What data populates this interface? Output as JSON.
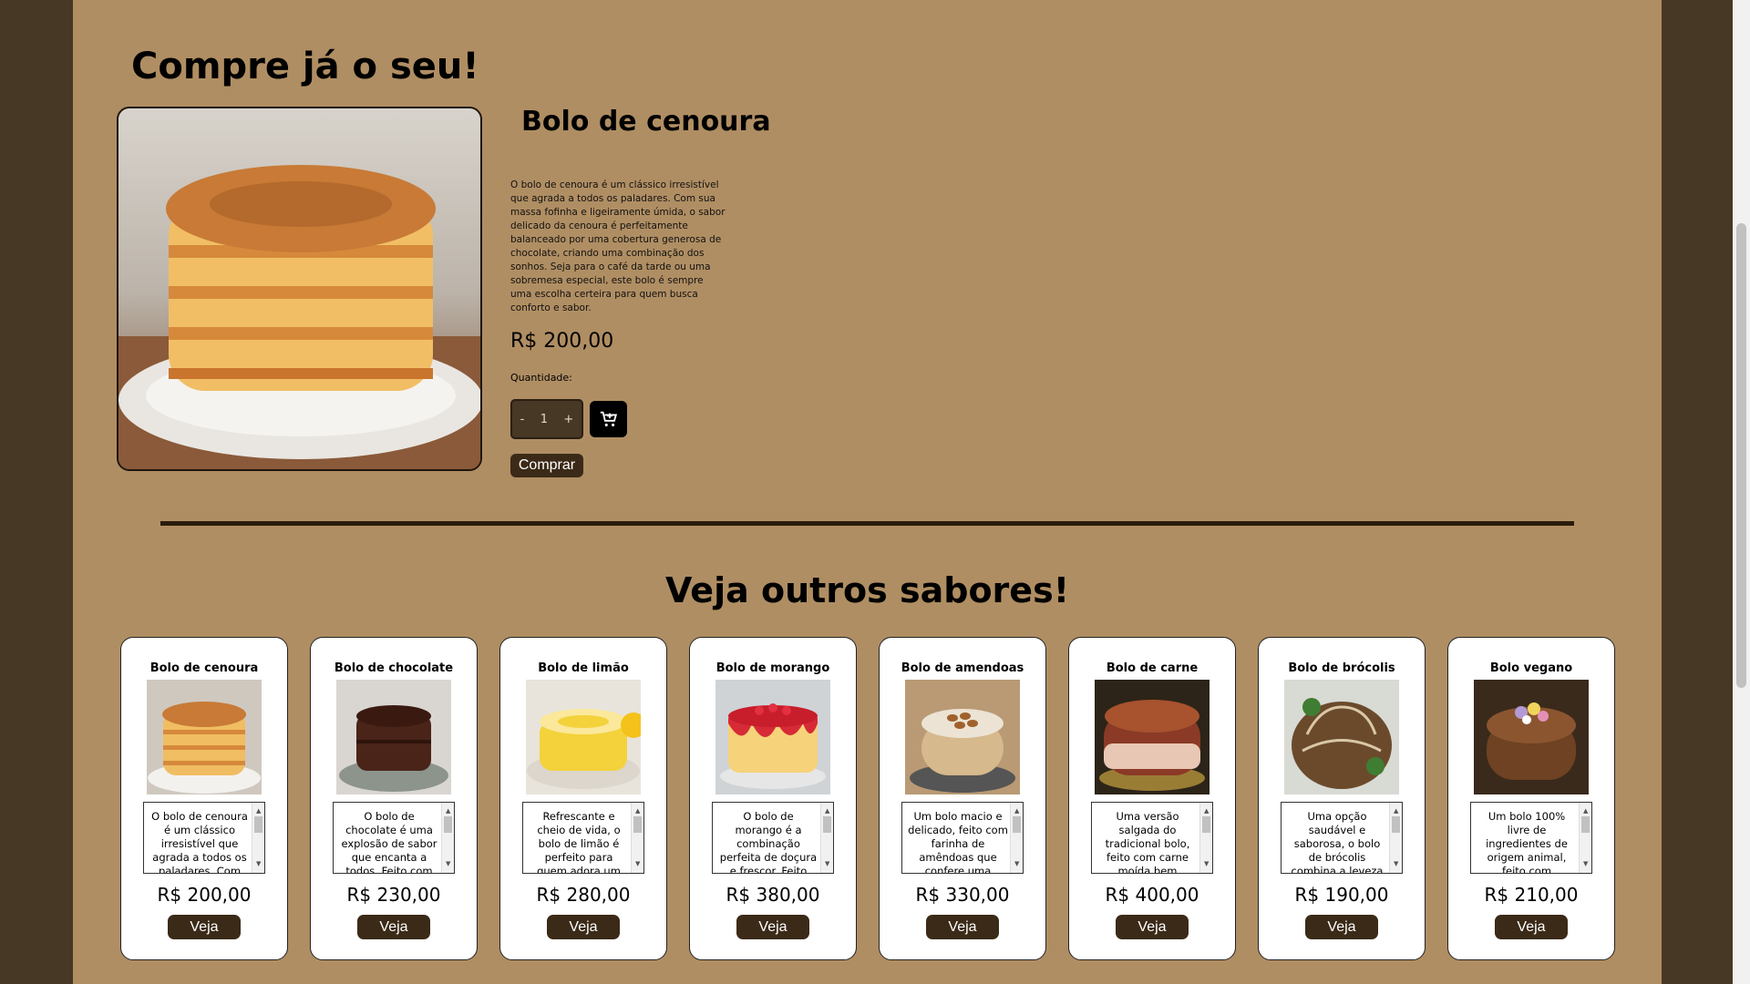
{
  "section_title": "Compre já o seu!",
  "product": {
    "name": "Bolo de cenoura",
    "description": "O bolo de cenoura é um clássico irresistível que agrada a todos os paladares. Com sua massa fofinha e ligeiramente úmida, o sabor delicado da cenoura é perfeitamente balanceado por uma cobertura generosa de chocolate, criando uma combinação dos sonhos. Seja para o café da tarde ou uma sobremesa especial, este bolo é sempre uma escolha certeira para quem busca conforto e sabor.",
    "price": "R$ 200,00",
    "quantity_label": "Quantidade:",
    "quantity_minus": "-",
    "quantity_value": "1",
    "quantity_plus": "+",
    "cart_icon": "cart-add-icon",
    "buy_label": "Comprar"
  },
  "others_title": "Veja outros sabores!",
  "cards": [
    {
      "title": "Bolo de cenoura",
      "desc": "O bolo de cenoura é um clássico irresistível que agrada a todos os paladares. Com",
      "price": "R$ 200,00",
      "button": "Veja"
    },
    {
      "title": "Bolo de chocolate",
      "desc": "O bolo de chocolate é uma explosão de sabor que encanta a todos. Feito com",
      "price": "R$ 230,00",
      "button": "Veja"
    },
    {
      "title": "Bolo de limão",
      "desc": "Refrescante e cheio de vida, o bolo de limão é perfeito para quem adora um",
      "price": "R$ 280,00",
      "button": "Veja"
    },
    {
      "title": "Bolo de morango",
      "desc": "O bolo de morango é a combinação perfeita de doçura e frescor. Feito",
      "price": "R$ 380,00",
      "button": "Veja"
    },
    {
      "title": "Bolo de amendoas",
      "desc": "Um bolo macio e delicado, feito com farinha de amêndoas que confere uma",
      "price": "R$ 330,00",
      "button": "Veja"
    },
    {
      "title": "Bolo de carne",
      "desc": "Uma versão salgada do tradicional bolo, feito com carne moída bem",
      "price": "R$ 400,00",
      "button": "Veja"
    },
    {
      "title": "Bolo de brócolis",
      "desc": "Uma opção saudável e saborosa, o bolo de brócolis combina a leveza",
      "price": "R$ 190,00",
      "button": "Veja"
    },
    {
      "title": "Bolo vegano",
      "desc": "Um bolo 100% livre de ingredientes de origem animal, feito com",
      "price": "R$ 210,00",
      "button": "Veja"
    }
  ]
}
